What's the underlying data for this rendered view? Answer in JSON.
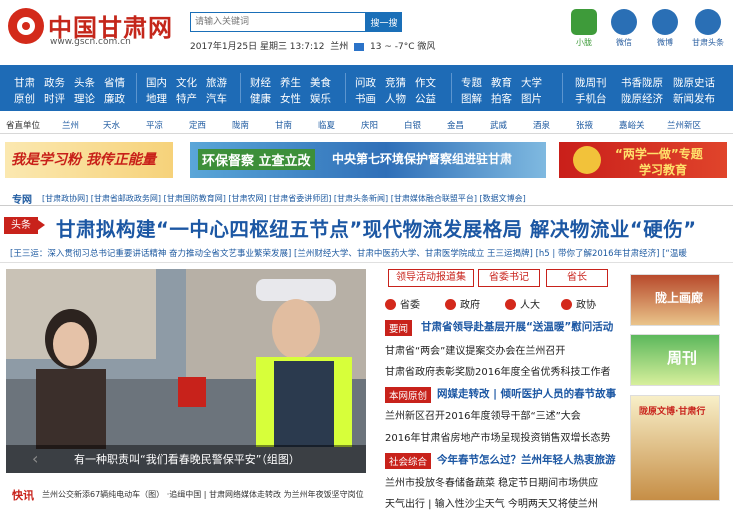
{
  "header": {
    "site_name": "中国甘肃网",
    "site_url": "www.gscn.com.cn",
    "search_placeholder": "请输入关键词",
    "search_button": "搜一搜",
    "date": "2017年1月25日 星期三 13:7:12",
    "city": "兰州",
    "weather": "13 ~ -7°C 微风",
    "icons": [
      {
        "label": "小胧",
        "icon": "app-icon"
      },
      {
        "label": "微信",
        "icon": "wechat-icon"
      },
      {
        "label": "微博",
        "icon": "weibo-icon"
      },
      {
        "label": "甘肃头条",
        "icon": "toutiao-icon"
      }
    ]
  },
  "nav": {
    "groups": [
      [
        [
          "甘肃",
          "政务",
          "头条",
          "省情"
        ],
        [
          "原创",
          "时评",
          "理论",
          "廉政"
        ]
      ],
      [
        [
          "国内",
          "文化",
          "旅游"
        ],
        [
          "地理",
          "特产",
          "汽车"
        ]
      ],
      [
        [
          "财经",
          "养生",
          "美食"
        ],
        [
          "健康",
          "女性",
          "娱乐"
        ]
      ],
      [
        [
          "问政",
          "竞猜",
          "作文"
        ],
        [
          "书画",
          "人物",
          "公益"
        ]
      ],
      [
        [
          "专题",
          "教育",
          "大学"
        ],
        [
          "图解",
          "拍客",
          "图片"
        ]
      ],
      [
        [
          "陇周刊",
          "书香陇原",
          "陇原史话"
        ],
        [
          "手机台",
          "陇原经济",
          "新闻发布"
        ]
      ]
    ]
  },
  "citybar": [
    "省直单位",
    "兰州",
    "天水",
    "平凉",
    "定西",
    "陇南",
    "甘南",
    "临夏",
    "庆阳",
    "白银",
    "金昌",
    "武威",
    "酒泉",
    "张掖",
    "嘉峪关",
    "兰州新区"
  ],
  "banners": {
    "b1": "我是学习粉 我传正能量",
    "b2_a": "环保督察 立查立改",
    "b2_b": "中央第七环境保护督察组进驻甘肃",
    "b3_a": "“两学一做”专题",
    "b3_b": "学习教育"
  },
  "special": {
    "label": "专网",
    "links": "[甘肃政协网] [甘肃省邮政政务网] [甘肃国防教育网] [甘肃农网] [甘肃省委讲师团] [甘肃头条新闻] [甘肃媒体融合联盟平台] [数据文博会]"
  },
  "headline": {
    "tag": "头条",
    "text": "甘肃拟构建“一中心四枢纽五节点”现代物流发展格局 解决物流业“硬伤”"
  },
  "subline": "[王三运：深入贯彻习总书记重要讲话精神 奋力推动全省文艺事业繁荣发展] [兰州财经大学、甘肃中医药大学、甘肃医学院成立 王三运揭牌] [h5 | 带你了解2016年甘肃经济] [“温暖",
  "photo": {
    "caption": "有一种职责叫“我们看春晚民警保平安”（组图）"
  },
  "kuaixun": {
    "label": "快讯",
    "text": "兰州公交新添67辆纯电动车（图）  ·追缉中国 | 甘肃网络媒体走转改 为兰州年夜饭坚守岗位"
  },
  "middle": {
    "tabs": [
      "领导活动报道集",
      "省委书记",
      "省长"
    ],
    "party": [
      "省委",
      "政府",
      "人大",
      "政协"
    ],
    "rows": [
      {
        "tag": "要闻",
        "title": "甘肃省领导赴基层开展“送温暖”慰问活动"
      },
      {
        "text": "甘肃省“两会”建议提案交办会在兰州召开"
      },
      {
        "text": "甘肃省政府表彰奖励2016年度全省优秀科技工作者"
      },
      {
        "tag": "本网原创",
        "title": "网媒走转改 | 倾听医护人员的春节故事"
      },
      {
        "text": "兰州新区召开2016年度领导干部“三述”大会"
      },
      {
        "text": "2016年甘肃省房地产市场呈现投资销售双增长态势"
      },
      {
        "tag": "社会综合",
        "title": "今年春节怎么过？兰州年轻人热衷旅游"
      },
      {
        "text": "兰州市投放冬春储备蔬菜 稳定节日期间市场供应"
      },
      {
        "text": "天气出行 | 输入性沙尘天气 今明两天又将使兰州"
      }
    ]
  },
  "side": {
    "s1": "陇上画廊",
    "s2": "周刊",
    "s3": "陇原文博·甘肃行"
  }
}
